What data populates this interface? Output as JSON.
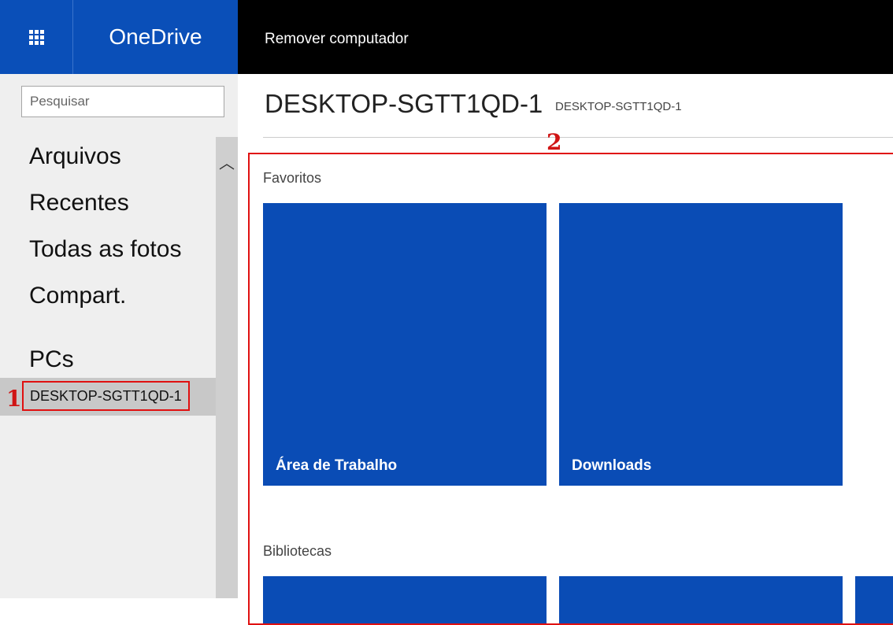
{
  "topbar": {
    "app_name": "OneDrive",
    "command_label": "Remover computador",
    "launcher_icon": "waffle-grid-icon",
    "background_color": "#000000",
    "brand_color": "#0a4fb8"
  },
  "search": {
    "placeholder": "Pesquisar"
  },
  "nav": {
    "items": [
      {
        "label": "Arquivos"
      },
      {
        "label": "Recentes"
      },
      {
        "label": "Todas as fotos"
      },
      {
        "label": "Compart."
      }
    ],
    "pcs_heading": "PCs",
    "pcs": [
      {
        "label": "DESKTOP-SGTT1QD-1",
        "selected": true
      }
    ],
    "scroll_up_icon": "chevron-up-icon"
  },
  "annotations": {
    "marker_1": "1",
    "marker_2": "2",
    "color": "#e01010"
  },
  "main": {
    "title": "DESKTOP-SGTT1QD-1",
    "subtitle": "DESKTOP-SGTT1QD-1",
    "favorites": {
      "label": "Favoritos",
      "tiles": [
        {
          "label": "Área de Trabalho"
        },
        {
          "label": "Downloads"
        }
      ]
    },
    "libraries": {
      "label": "Bibliotecas"
    },
    "tile_color": "#0a4cb5"
  }
}
